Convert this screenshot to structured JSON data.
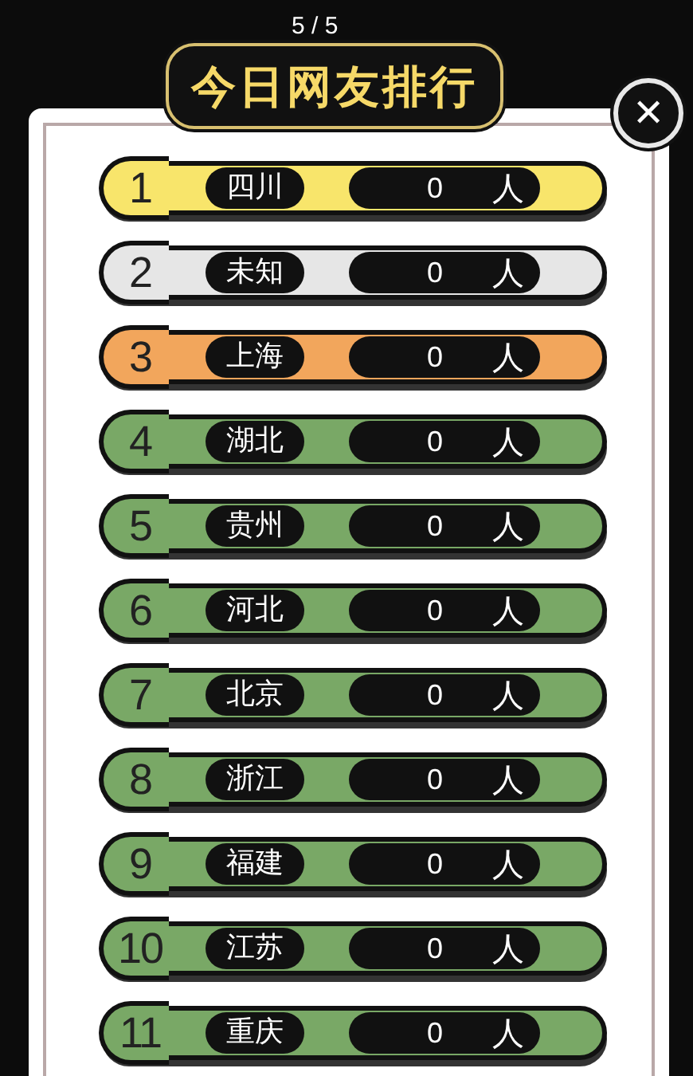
{
  "pager": "5 / 5",
  "title": "今日网友排行",
  "close": "✕",
  "rows": [
    {
      "rank": "1",
      "name": "四川",
      "count": "0",
      "unit": "人",
      "color": "#f8e56b"
    },
    {
      "rank": "2",
      "name": "未知",
      "count": "0",
      "unit": "人",
      "color": "#e6e6e6"
    },
    {
      "rank": "3",
      "name": "上海",
      "count": "0",
      "unit": "人",
      "color": "#f2a65c"
    },
    {
      "rank": "4",
      "name": "湖北",
      "count": "0",
      "unit": "人",
      "color": "#79a866"
    },
    {
      "rank": "5",
      "name": "贵州",
      "count": "0",
      "unit": "人",
      "color": "#79a866"
    },
    {
      "rank": "6",
      "name": "河北",
      "count": "0",
      "unit": "人",
      "color": "#79a866"
    },
    {
      "rank": "7",
      "name": "北京",
      "count": "0",
      "unit": "人",
      "color": "#79a866"
    },
    {
      "rank": "8",
      "name": "浙江",
      "count": "0",
      "unit": "人",
      "color": "#79a866"
    },
    {
      "rank": "9",
      "name": "福建",
      "count": "0",
      "unit": "人",
      "color": "#79a866"
    },
    {
      "rank": "10",
      "name": "江苏",
      "count": "0",
      "unit": "人",
      "color": "#79a866"
    },
    {
      "rank": "11",
      "name": "重庆",
      "count": "0",
      "unit": "人",
      "color": "#79a866"
    }
  ]
}
